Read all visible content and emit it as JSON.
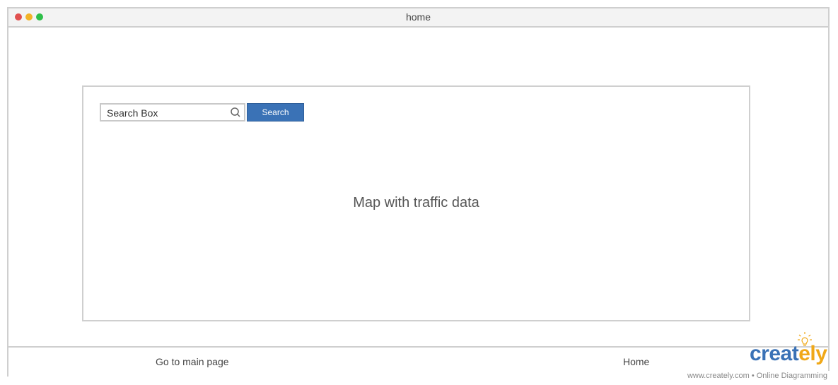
{
  "window": {
    "title": "home"
  },
  "traffic_lights": {
    "close_color": "#e0504f",
    "minimize_color": "#f2b328",
    "maximize_color": "#2fbf4a"
  },
  "map_panel": {
    "search": {
      "placeholder": "Search Box",
      "value": "Search Box",
      "button_label": "Search",
      "button_color": "#3a72b6",
      "icon": "search-icon"
    },
    "label": "Map with traffic data"
  },
  "footer": {
    "left_link": "Go to main page",
    "right_link": "Home"
  },
  "branding": {
    "logo_main": "creat",
    "logo_accent": "ely",
    "watermark": "www.creately.com • Online Diagramming"
  }
}
